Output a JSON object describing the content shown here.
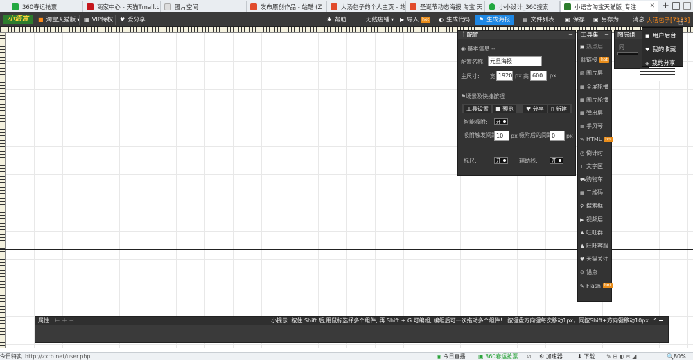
{
  "browser": {
    "tabs": [
      {
        "title": "360春运抢票",
        "color": "#23a840"
      },
      {
        "title": "商家中心 - 天猫Tmall.c",
        "color": "#c4161c"
      },
      {
        "title": "图片空间",
        "color": "#dddddd"
      },
      {
        "title": "发布原创作品 - 站酷 (Z",
        "color": "#e14b2c"
      },
      {
        "title": "大汤包子的个人主页 - 站",
        "color": "#e14b2c"
      },
      {
        "title": "圣诞节动态海报 淘宝 天",
        "color": "#e14b2c"
      },
      {
        "title": "小小设计_360搜索",
        "color": "#23a840"
      },
      {
        "title": "小语言淘宝天猫版_专注",
        "color": "#2d7d2d"
      }
    ],
    "plus": "+"
  },
  "toolbar": {
    "logo": "小语言",
    "shop": "淘宝天猫版",
    "vip": "VIP特权",
    "share": "爱分享",
    "help": "帮助",
    "wireless": "无线店铺",
    "import": "导入",
    "gencode": "生成代码",
    "genposter": "生成海报",
    "filelist": "文件列表",
    "save": "保存",
    "saveas": "另存为",
    "message": "消息",
    "user": "大汤包子[7333]",
    "hot": "hot"
  },
  "main_panel": {
    "title": "主配置",
    "basic": "基本信息 --",
    "name_label": "配置名称:",
    "name_value": "元旦海报",
    "size_label": "主尺寸:",
    "width_label": "宽",
    "width_value": "1920",
    "px": "px",
    "height_label": "高",
    "height_value": "600",
    "scene": "场景及快捷按钮",
    "tool_settings": "工具设置",
    "preview": "预览",
    "share": "分享",
    "new": "新建",
    "smart_snap": "智能吸附:",
    "on": "开",
    "snap_trigger": "吸附触发间距:",
    "snap_trigger_value": "10",
    "snap_after": "吸附后的间距:",
    "snap_after_value": "0",
    "ruler": "标尺:",
    "guide": "辅助线:"
  },
  "tools": {
    "title": "工具集",
    "items": [
      {
        "label": "热点层",
        "icon": "hotspot-icon",
        "dim": true
      },
      {
        "label": "链接",
        "icon": "link-icon",
        "hot": true
      },
      {
        "label": "图片层",
        "icon": "image-icon"
      },
      {
        "label": "全屏轮播",
        "icon": "fullscreen-carousel-icon"
      },
      {
        "label": "图片轮播",
        "icon": "image-carousel-icon"
      },
      {
        "label": "弹出层",
        "icon": "popup-icon"
      },
      {
        "label": "手风琴",
        "icon": "accordion-icon"
      },
      {
        "label": "HTML",
        "icon": "html-icon",
        "hot": true
      },
      {
        "label": "倒计时",
        "icon": "countdown-icon"
      },
      {
        "label": "文字区",
        "icon": "text-icon"
      },
      {
        "label": "购物车",
        "icon": "cart-icon"
      },
      {
        "label": "二维码",
        "icon": "qrcode-icon"
      },
      {
        "label": "搜索框",
        "icon": "search-icon"
      },
      {
        "label": "视频层",
        "icon": "video-icon"
      },
      {
        "label": "旺旺群",
        "icon": "group-icon"
      },
      {
        "label": "旺旺客服",
        "icon": "service-icon"
      },
      {
        "label": "天猫关注",
        "icon": "heart-icon"
      },
      {
        "label": "锚点",
        "icon": "anchor-icon"
      },
      {
        "label": "Flash",
        "icon": "flash-icon",
        "hot": true
      }
    ]
  },
  "layers": {
    "title": "图层组",
    "sub": "同"
  },
  "dropdown": {
    "items": [
      "用户后台",
      "我的收藏",
      "我的分享"
    ]
  },
  "property_bar": {
    "title": "属性",
    "tip": "小提示: 按住 Shift 后,用鼠标选择多个组件, 再 Shift + G 可编组, 编组后可一次拖动多个组件！ 按键盘方向键每次移动1px，同按Shift+方向键移动10px"
  },
  "status_bar": {
    "left": "今日特卖",
    "url": "http://zxtb.net/user.php",
    "live": "今日直播",
    "ticket": "360春运抢票",
    "accel": "加速器",
    "download": "下载",
    "zoom": "80%"
  }
}
